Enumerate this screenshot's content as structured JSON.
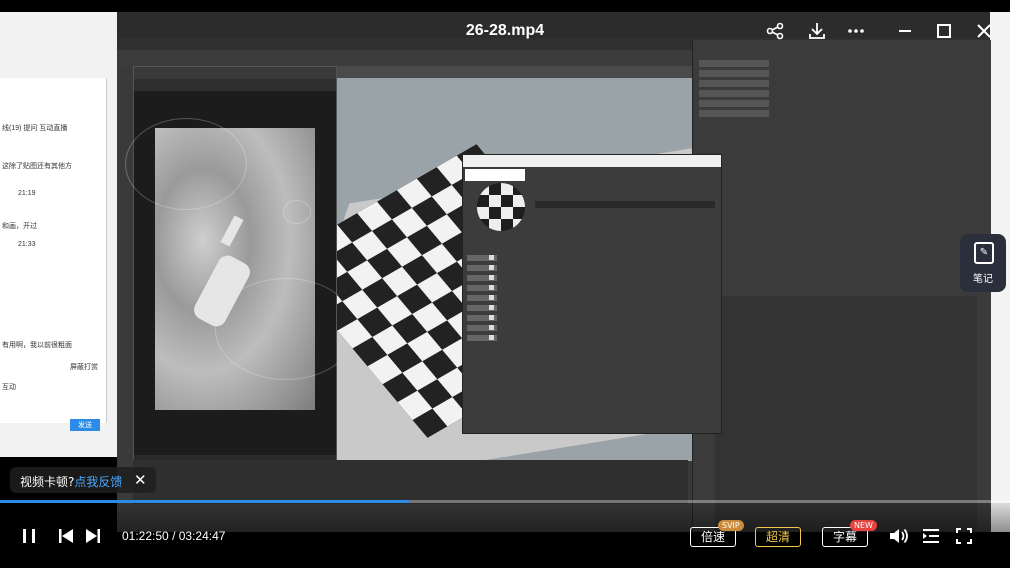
{
  "player": {
    "title": "26-28.mp4",
    "current_time": "01:22:50",
    "separator": "/",
    "duration": "03:24:47",
    "progress": 0.405,
    "accent": "#2b8be6",
    "buttons": {
      "speed": "倍速",
      "speed_badge": "SVIP",
      "quality": "超清",
      "subtitle": "字幕",
      "subtitle_badge": "NEW"
    },
    "note_label": "笔记",
    "feedback": {
      "text": "视频卡顿?",
      "link": "点我反馈"
    },
    "icons": [
      "share-icon",
      "download-icon",
      "more-icon",
      "minimize-icon",
      "maximize-icon",
      "close-icon",
      "pause-icon",
      "prev-icon",
      "next-icon",
      "volume-icon",
      "playlist-icon",
      "fullscreen-icon"
    ]
  },
  "background_chat": {
    "lines": [
      {
        "text": "线(19)   提问   互动直播"
      },
      {
        "text": "这除了贴图还有其他方"
      },
      {
        "text": "21:19"
      },
      {
        "text": "和画，开过"
      },
      {
        "text": "21:33"
      },
      {
        "text": "有用啊，我以前很粗面"
      },
      {
        "text": "屏蔽打赏"
      },
      {
        "text": "互动"
      }
    ],
    "send_label": "发送"
  }
}
